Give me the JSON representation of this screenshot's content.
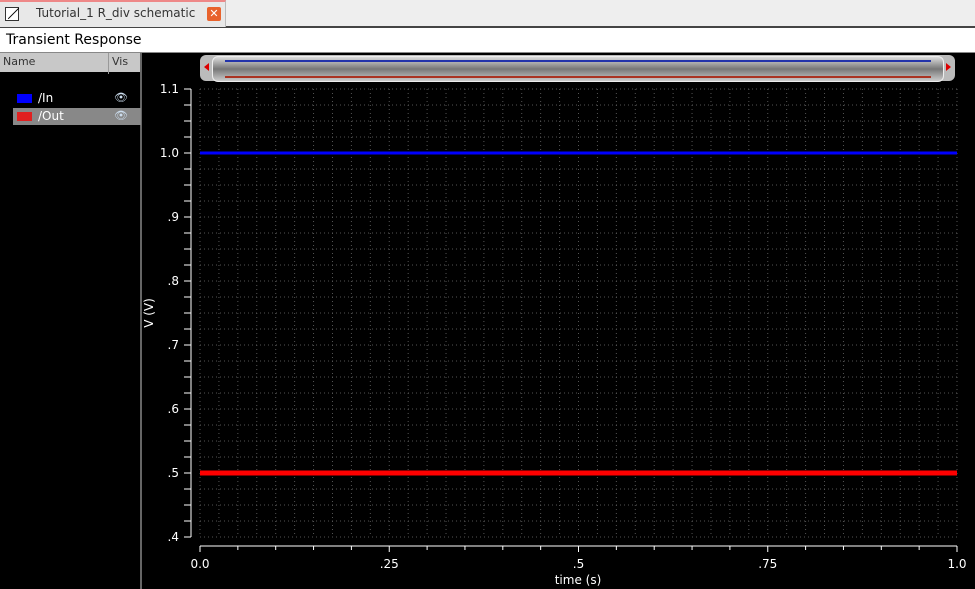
{
  "tab": {
    "title": "Tutorial_1 R_div schematic",
    "close": "✕"
  },
  "window_title": "Transient Response",
  "legend": {
    "name_header": "Name",
    "vis_header": "Vis",
    "items": [
      {
        "label": "/In",
        "color": "#0000ff"
      },
      {
        "label": "/Out",
        "color": "#ff0000"
      }
    ]
  },
  "chart_data": {
    "type": "line",
    "xlabel": "time (s)",
    "ylabel": "V (V)",
    "xlim": [
      0,
      1
    ],
    "ylim": [
      0.4,
      1.1
    ],
    "x_ticks": [
      {
        "v": 0,
        "label": "0.0"
      },
      {
        "v": 0.25,
        "label": ".25"
      },
      {
        "v": 0.5,
        "label": ".5"
      },
      {
        "v": 0.75,
        "label": ".75"
      },
      {
        "v": 1,
        "label": "1.0"
      }
    ],
    "y_ticks": [
      {
        "v": 1.1,
        "label": "1.1"
      },
      {
        "v": 1.0,
        "label": "1.0"
      },
      {
        "v": 0.9,
        "label": ".9"
      },
      {
        "v": 0.8,
        "label": ".8"
      },
      {
        "v": 0.7,
        "label": ".7"
      },
      {
        "v": 0.6,
        "label": ".6"
      },
      {
        "v": 0.5,
        "label": ".5"
      },
      {
        "v": 0.4,
        "label": ".4"
      }
    ],
    "series": [
      {
        "name": "/In",
        "color": "#0000ff",
        "x": [
          0,
          1
        ],
        "y": [
          1.0,
          1.0
        ]
      },
      {
        "name": "/Out",
        "color": "#ff0000",
        "x": [
          0,
          1
        ],
        "y": [
          0.5,
          0.5
        ]
      }
    ],
    "grid": true
  }
}
